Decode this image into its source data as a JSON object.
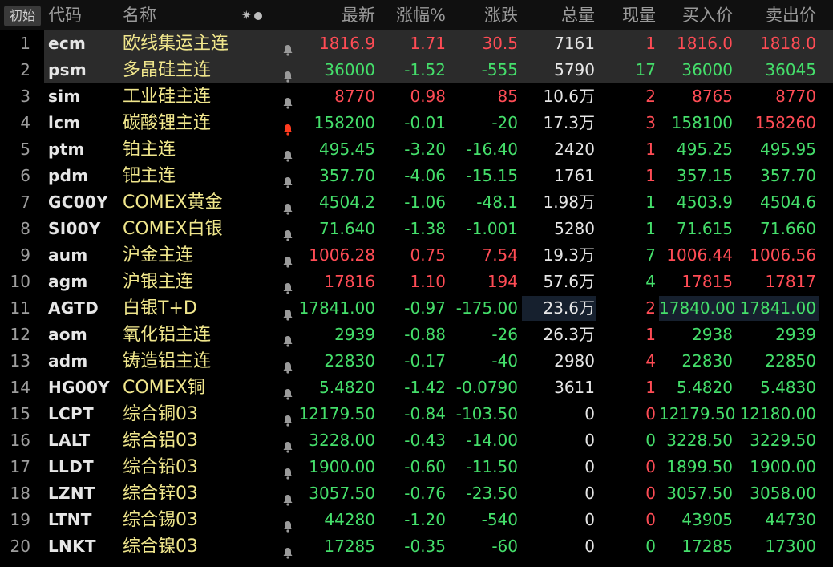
{
  "header": {
    "reset_label": "初始",
    "col_code": "代码",
    "col_name": "名称",
    "col_last": "最新",
    "col_pct": "涨幅%",
    "col_change": "涨跌",
    "col_volume": "总量",
    "col_cur": "现量",
    "col_bid": "买入价",
    "col_ask": "卖出价",
    "star_glyph": "✷"
  },
  "colors": {
    "up": "#ff4c55",
    "down": "#45df6b",
    "name": "#f0e68c",
    "alert_bell": "#ff3b1f",
    "bell": "#9a9a9a"
  },
  "rows": [
    {
      "idx": "1",
      "code": "ecm",
      "name": "欧线集运主连",
      "last": "1816.9",
      "pct": "1.71",
      "chg": "30.5",
      "vol": "7161",
      "cur": "1",
      "bid": "1816.0",
      "ask": "1818.0",
      "dir": "up",
      "cur_dir": "up",
      "bid_dir": "up",
      "ask_dir": "up",
      "alert": false
    },
    {
      "idx": "2",
      "code": "psm",
      "name": "多晶硅主连",
      "last": "36000",
      "pct": "-1.52",
      "chg": "-555",
      "vol": "5790",
      "cur": "17",
      "bid": "36000",
      "ask": "36045",
      "dir": "dn",
      "cur_dir": "dn",
      "bid_dir": "dn",
      "ask_dir": "dn",
      "alert": false
    },
    {
      "idx": "3",
      "code": "sim",
      "name": "工业硅主连",
      "last": "8770",
      "pct": "0.98",
      "chg": "85",
      "vol": "10.6万",
      "cur": "2",
      "bid": "8765",
      "ask": "8770",
      "dir": "up",
      "cur_dir": "up",
      "bid_dir": "up",
      "ask_dir": "up",
      "alert": false
    },
    {
      "idx": "4",
      "code": "lcm",
      "name": "碳酸锂主连",
      "last": "158200",
      "pct": "-0.01",
      "chg": "-20",
      "vol": "17.3万",
      "cur": "3",
      "bid": "158100",
      "ask": "158260",
      "dir": "dn",
      "cur_dir": "up",
      "bid_dir": "dn",
      "ask_dir": "up",
      "alert": true
    },
    {
      "idx": "5",
      "code": "ptm",
      "name": "铂主连",
      "last": "495.45",
      "pct": "-3.20",
      "chg": "-16.40",
      "vol": "2420",
      "cur": "1",
      "bid": "495.25",
      "ask": "495.95",
      "dir": "dn",
      "cur_dir": "up",
      "bid_dir": "dn",
      "ask_dir": "dn",
      "alert": false
    },
    {
      "idx": "6",
      "code": "pdm",
      "name": "钯主连",
      "last": "357.70",
      "pct": "-4.06",
      "chg": "-15.15",
      "vol": "1761",
      "cur": "1",
      "bid": "357.15",
      "ask": "357.70",
      "dir": "dn",
      "cur_dir": "up",
      "bid_dir": "dn",
      "ask_dir": "dn",
      "alert": false
    },
    {
      "idx": "7",
      "code": "GC00Y",
      "name": "COMEX黄金",
      "last": "4504.2",
      "pct": "-1.06",
      "chg": "-48.1",
      "vol": "1.98万",
      "cur": "1",
      "bid": "4503.9",
      "ask": "4504.6",
      "dir": "dn",
      "cur_dir": "dn",
      "bid_dir": "dn",
      "ask_dir": "dn",
      "alert": false
    },
    {
      "idx": "8",
      "code": "SI00Y",
      "name": "COMEX白银",
      "last": "71.640",
      "pct": "-1.38",
      "chg": "-1.001",
      "vol": "5280",
      "cur": "1",
      "bid": "71.615",
      "ask": "71.660",
      "dir": "dn",
      "cur_dir": "dn",
      "bid_dir": "dn",
      "ask_dir": "dn",
      "alert": false
    },
    {
      "idx": "9",
      "code": "aum",
      "name": "沪金主连",
      "last": "1006.28",
      "pct": "0.75",
      "chg": "7.54",
      "vol": "19.3万",
      "cur": "7",
      "bid": "1006.44",
      "ask": "1006.56",
      "dir": "up",
      "cur_dir": "dn",
      "bid_dir": "up",
      "ask_dir": "up",
      "alert": false
    },
    {
      "idx": "10",
      "code": "agm",
      "name": "沪银主连",
      "last": "17816",
      "pct": "1.10",
      "chg": "194",
      "vol": "57.6万",
      "cur": "4",
      "bid": "17815",
      "ask": "17817",
      "dir": "up",
      "cur_dir": "dn",
      "bid_dir": "up",
      "ask_dir": "up",
      "alert": false
    },
    {
      "idx": "11",
      "code": "AGTD",
      "name": "白银T+D",
      "last": "17841.00",
      "pct": "-0.97",
      "chg": "-175.00",
      "vol": "23.6万",
      "cur": "2",
      "bid": "17840.00",
      "ask": "17841.00",
      "dir": "dn",
      "cur_dir": "up",
      "bid_dir": "dn",
      "ask_dir": "dn",
      "alert": false,
      "boxed": true
    },
    {
      "idx": "12",
      "code": "aom",
      "name": "氧化铝主连",
      "last": "2939",
      "pct": "-0.88",
      "chg": "-26",
      "vol": "26.3万",
      "cur": "1",
      "bid": "2938",
      "ask": "2939",
      "dir": "dn",
      "cur_dir": "up",
      "bid_dir": "dn",
      "ask_dir": "dn",
      "alert": false
    },
    {
      "idx": "13",
      "code": "adm",
      "name": "铸造铝主连",
      "last": "22830",
      "pct": "-0.17",
      "chg": "-40",
      "vol": "2980",
      "cur": "4",
      "bid": "22830",
      "ask": "22850",
      "dir": "dn",
      "cur_dir": "up",
      "bid_dir": "dn",
      "ask_dir": "dn",
      "alert": false
    },
    {
      "idx": "14",
      "code": "HG00Y",
      "name": "COMEX铜",
      "last": "5.4820",
      "pct": "-1.42",
      "chg": "-0.0790",
      "vol": "3611",
      "cur": "1",
      "bid": "5.4820",
      "ask": "5.4830",
      "dir": "dn",
      "cur_dir": "up",
      "bid_dir": "dn",
      "ask_dir": "dn",
      "alert": false
    },
    {
      "idx": "15",
      "code": "LCPT",
      "name": "综合铜03",
      "last": "12179.50",
      "pct": "-0.84",
      "chg": "-103.50",
      "vol": "0",
      "cur": "0",
      "bid": "12179.50",
      "ask": "12180.00",
      "dir": "dn",
      "cur_dir": "up",
      "bid_dir": "dn",
      "ask_dir": "dn",
      "alert": false
    },
    {
      "idx": "16",
      "code": "LALT",
      "name": "综合铝03",
      "last": "3228.00",
      "pct": "-0.43",
      "chg": "-14.00",
      "vol": "0",
      "cur": "0",
      "bid": "3228.50",
      "ask": "3229.50",
      "dir": "dn",
      "cur_dir": "dn",
      "bid_dir": "dn",
      "ask_dir": "dn",
      "alert": false
    },
    {
      "idx": "17",
      "code": "LLDT",
      "name": "综合铅03",
      "last": "1900.00",
      "pct": "-0.60",
      "chg": "-11.50",
      "vol": "0",
      "cur": "0",
      "bid": "1899.50",
      "ask": "1900.00",
      "dir": "dn",
      "cur_dir": "up",
      "bid_dir": "dn",
      "ask_dir": "dn",
      "alert": false
    },
    {
      "idx": "18",
      "code": "LZNT",
      "name": "综合锌03",
      "last": "3057.50",
      "pct": "-0.76",
      "chg": "-23.50",
      "vol": "0",
      "cur": "0",
      "bid": "3057.50",
      "ask": "3058.00",
      "dir": "dn",
      "cur_dir": "up",
      "bid_dir": "dn",
      "ask_dir": "dn",
      "alert": false
    },
    {
      "idx": "19",
      "code": "LTNT",
      "name": "综合锡03",
      "last": "44280",
      "pct": "-1.20",
      "chg": "-540",
      "vol": "0",
      "cur": "0",
      "bid": "43905",
      "ask": "44730",
      "dir": "dn",
      "cur_dir": "up",
      "bid_dir": "dn",
      "ask_dir": "dn",
      "alert": false
    },
    {
      "idx": "20",
      "code": "LNKT",
      "name": "综合镍03",
      "last": "17285",
      "pct": "-0.35",
      "chg": "-60",
      "vol": "0",
      "cur": "0",
      "bid": "17285",
      "ask": "17300",
      "dir": "dn",
      "cur_dir": "dn",
      "bid_dir": "dn",
      "ask_dir": "dn",
      "alert": false
    }
  ]
}
